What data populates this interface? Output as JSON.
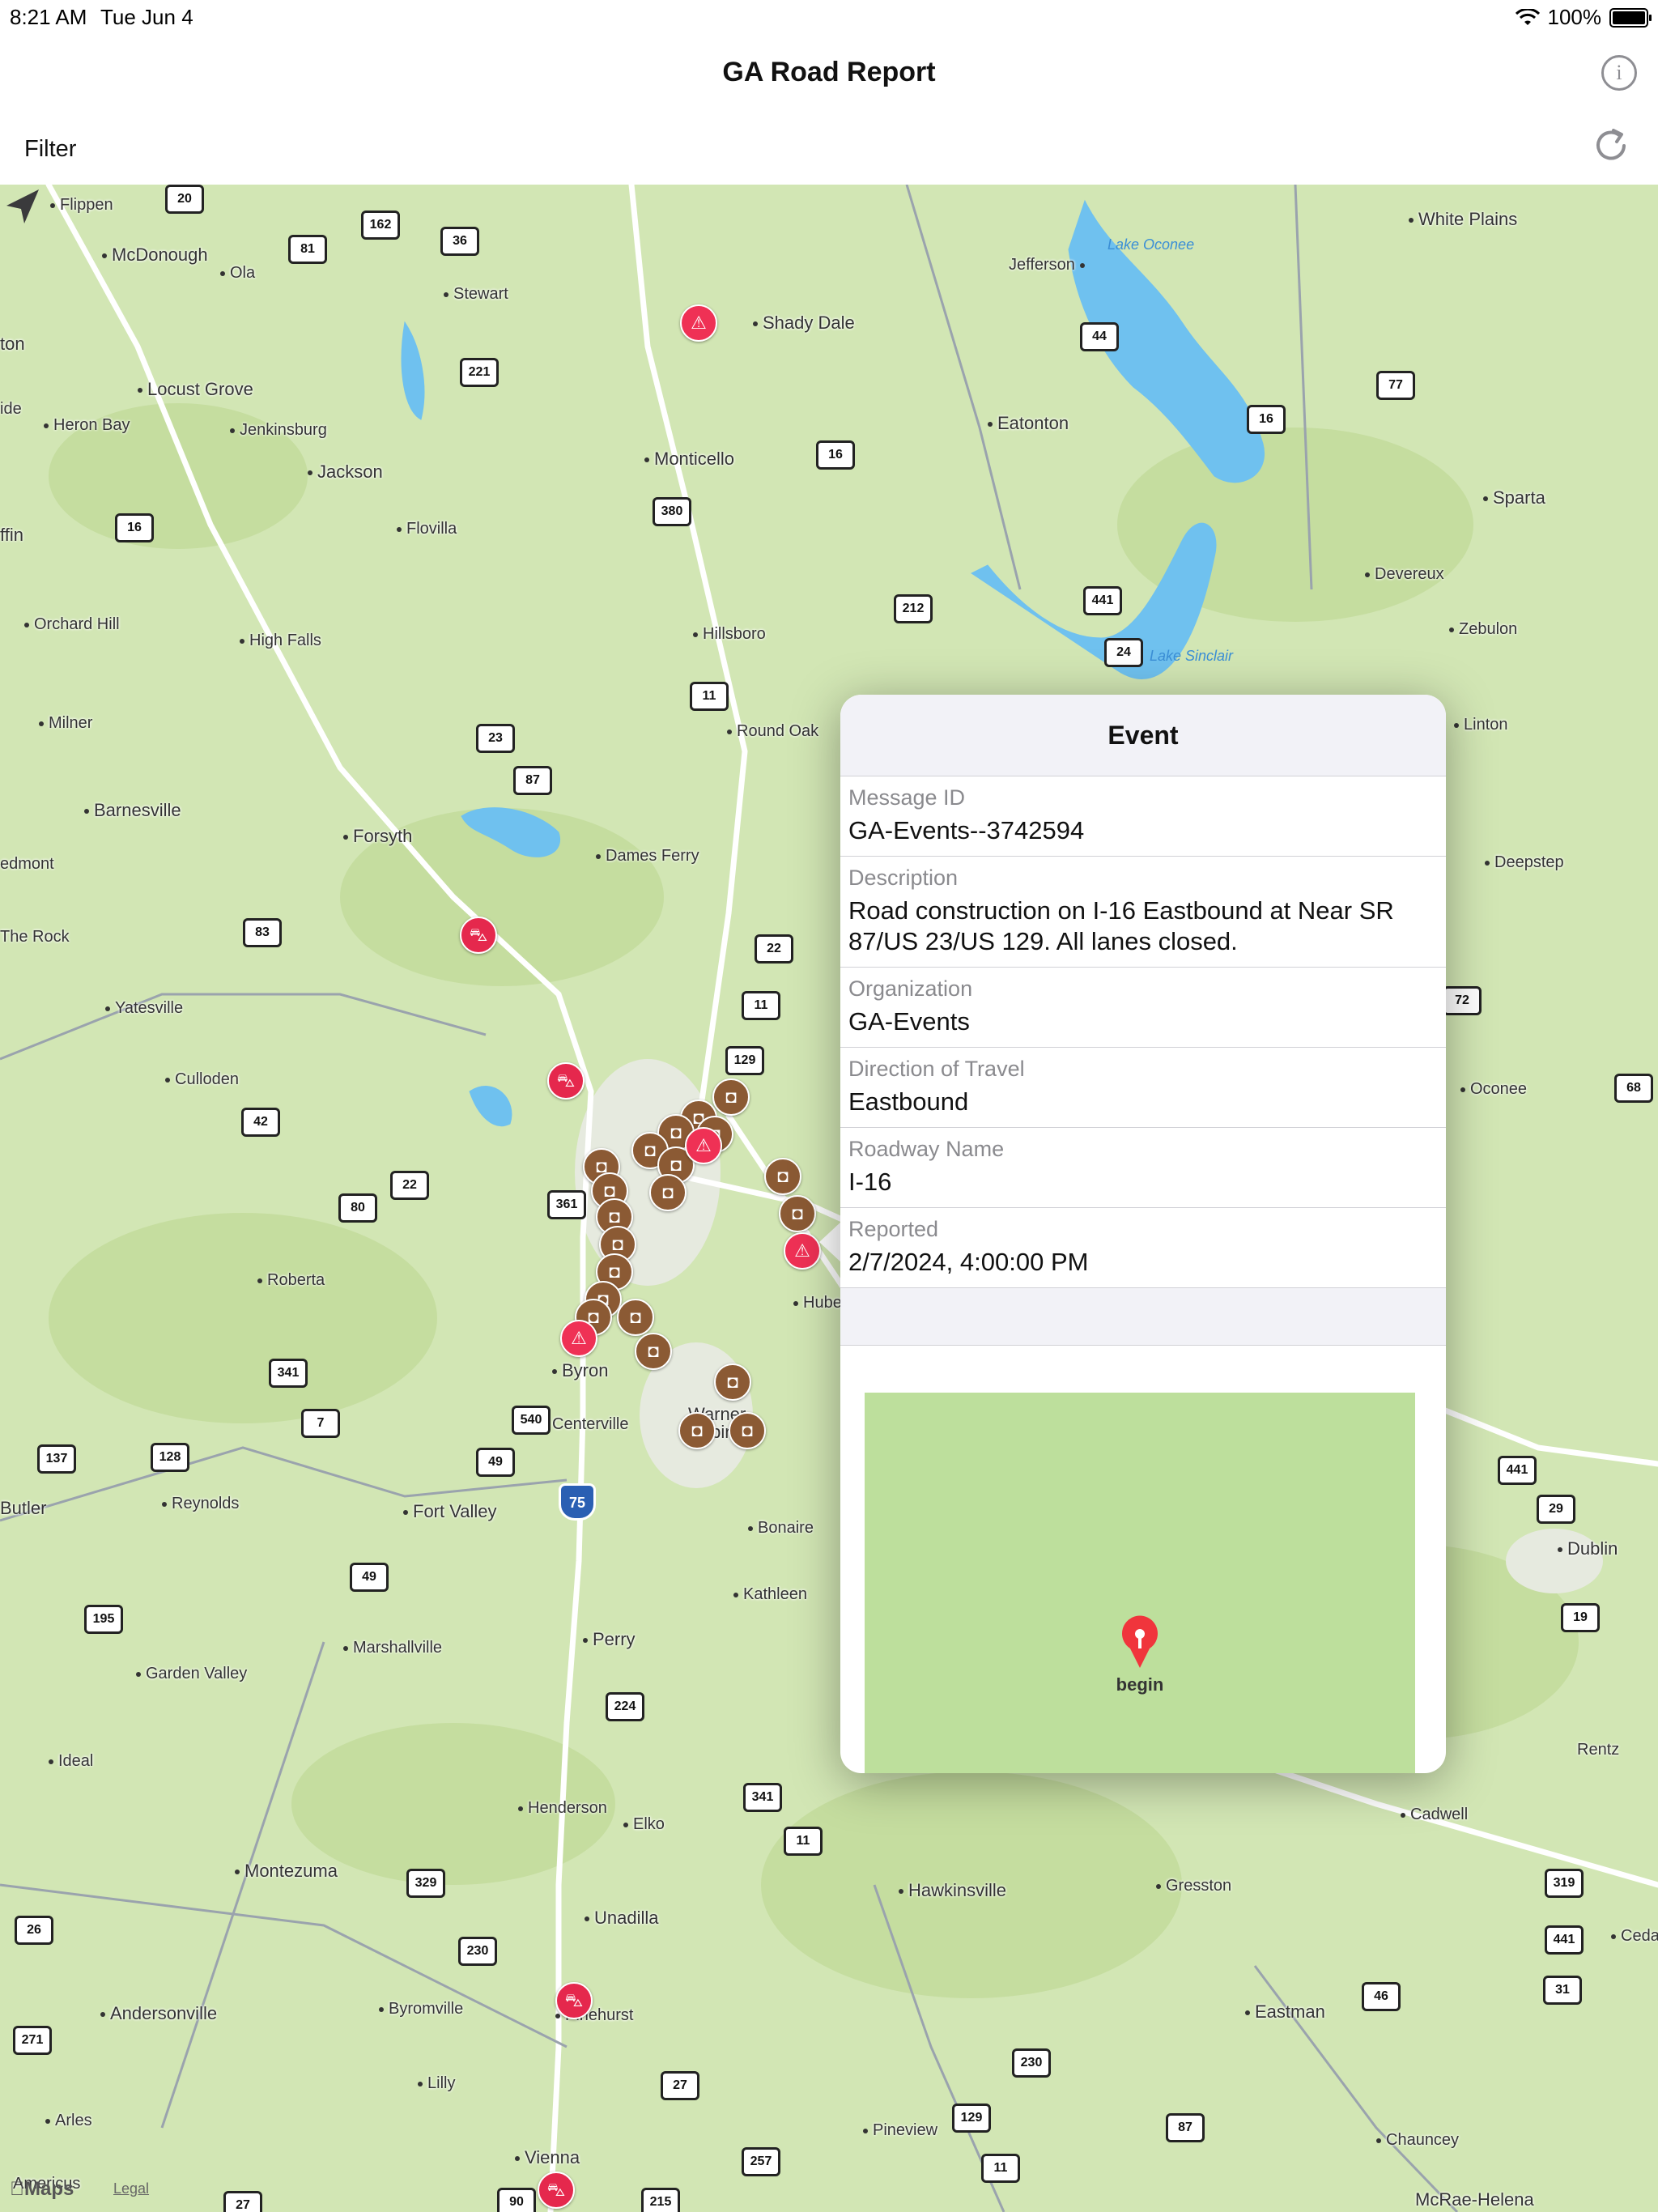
{
  "status_bar": {
    "time": "8:21 AM",
    "date": "Tue Jun 4",
    "battery": "100%"
  },
  "nav": {
    "title": "GA Road Report",
    "filter_label": "Filter",
    "info_icon": "info-icon",
    "refresh_icon": "refresh-icon"
  },
  "map": {
    "places": [
      {
        "name": "Flippen"
      },
      {
        "name": "McDonough"
      },
      {
        "name": "Ola"
      },
      {
        "name": "Stewart"
      },
      {
        "name": "Shady Dale"
      },
      {
        "name": "Jefferson"
      },
      {
        "name": "White Plains"
      },
      {
        "name": "Locust Grove"
      },
      {
        "name": "Heron Bay"
      },
      {
        "name": "Jenkinsburg"
      },
      {
        "name": "Jackson"
      },
      {
        "name": "Monticello"
      },
      {
        "name": "Eatonton"
      },
      {
        "name": "Sparta"
      },
      {
        "name": "Flovilla"
      },
      {
        "name": "Devereux"
      },
      {
        "name": "Orchard Hill"
      },
      {
        "name": "High Falls"
      },
      {
        "name": "Hillsboro"
      },
      {
        "name": "Zebulon"
      },
      {
        "name": "Milner"
      },
      {
        "name": "Round Oak"
      },
      {
        "name": "Linton"
      },
      {
        "name": "Barnesville"
      },
      {
        "name": "Forsyth"
      },
      {
        "name": "Dames Ferry"
      },
      {
        "name": "Deepstep"
      },
      {
        "name": "The Rock"
      },
      {
        "name": "Yatesville"
      },
      {
        "name": "Culloden"
      },
      {
        "name": "Oconee"
      },
      {
        "name": "Roberta"
      },
      {
        "name": "Byron"
      },
      {
        "name": "Centerville"
      },
      {
        "name": "Warner Robins"
      },
      {
        "name": "Butler"
      },
      {
        "name": "Reynolds"
      },
      {
        "name": "Fort Valley"
      },
      {
        "name": "Bonaire"
      },
      {
        "name": "Dublin"
      },
      {
        "name": "Kathleen"
      },
      {
        "name": "Marshallville"
      },
      {
        "name": "Perry"
      },
      {
        "name": "Garden Valley"
      },
      {
        "name": "Rentz"
      },
      {
        "name": "Ideal"
      },
      {
        "name": "Henderson"
      },
      {
        "name": "Elko"
      },
      {
        "name": "Cadwell"
      },
      {
        "name": "Montezuma"
      },
      {
        "name": "Hawkinsville"
      },
      {
        "name": "Gresston"
      },
      {
        "name": "Unadilla"
      },
      {
        "name": "Cedar G"
      },
      {
        "name": "Andersonville"
      },
      {
        "name": "Byromville"
      },
      {
        "name": "Pinehurst"
      },
      {
        "name": "Eastman"
      },
      {
        "name": "Lilly"
      },
      {
        "name": "Arles"
      },
      {
        "name": "Pineview"
      },
      {
        "name": "Chauncey"
      },
      {
        "name": "Vienna"
      },
      {
        "name": "Americus"
      },
      {
        "name": "McRae-Helena"
      },
      {
        "name": "Huber"
      },
      {
        "name": "ton"
      },
      {
        "name": "ide"
      },
      {
        "name": "ffin"
      },
      {
        "name": "edmont"
      }
    ],
    "water": [
      {
        "name": "Lake Oconee"
      },
      {
        "name": "Lake Sinclair"
      }
    ],
    "routes": [
      "20",
      "162",
      "36",
      "81",
      "221",
      "44",
      "77",
      "16",
      "380",
      "16",
      "16",
      "212",
      "441",
      "24",
      "11",
      "23",
      "87",
      "83",
      "22",
      "11",
      "129",
      "72",
      "68",
      "42",
      "80",
      "22",
      "361",
      "341",
      "7",
      "540",
      "49",
      "137",
      "128",
      "441",
      "29",
      "195",
      "49",
      "224",
      "19",
      "341",
      "11",
      "329",
      "319",
      "26",
      "230",
      "441",
      "31",
      "46",
      "271",
      "27",
      "129",
      "230",
      "87",
      "257",
      "11",
      "215",
      "90",
      "27",
      "75"
    ],
    "attribution": "Maps",
    "legal": "Legal",
    "locate_icon": "location-arrow-icon"
  },
  "popover": {
    "title": "Event",
    "fields": [
      {
        "label": "Message ID",
        "value": "GA-Events--3742594"
      },
      {
        "label": "Description",
        "value": "Road construction on I-16 Eastbound at Near SR 87/US 23/US 129. All lanes closed."
      },
      {
        "label": "Organization",
        "value": "GA-Events"
      },
      {
        "label": "Direction of Travel",
        "value": "Eastbound"
      },
      {
        "label": "Roadway Name",
        "value": "I-16"
      },
      {
        "label": "Reported",
        "value": "2/7/2024, 4:00:00 PM"
      }
    ],
    "mini_map": {
      "pin_label": "begin",
      "pin_color": "#f0353c"
    }
  },
  "colors": {
    "map_bg": "#d2e6b4",
    "road": "#ffffff",
    "water": "#6fc1ef",
    "event_red": "#ef3155",
    "camera_brown": "#8b5a34",
    "interstate_blue": "#2a5fb3"
  }
}
